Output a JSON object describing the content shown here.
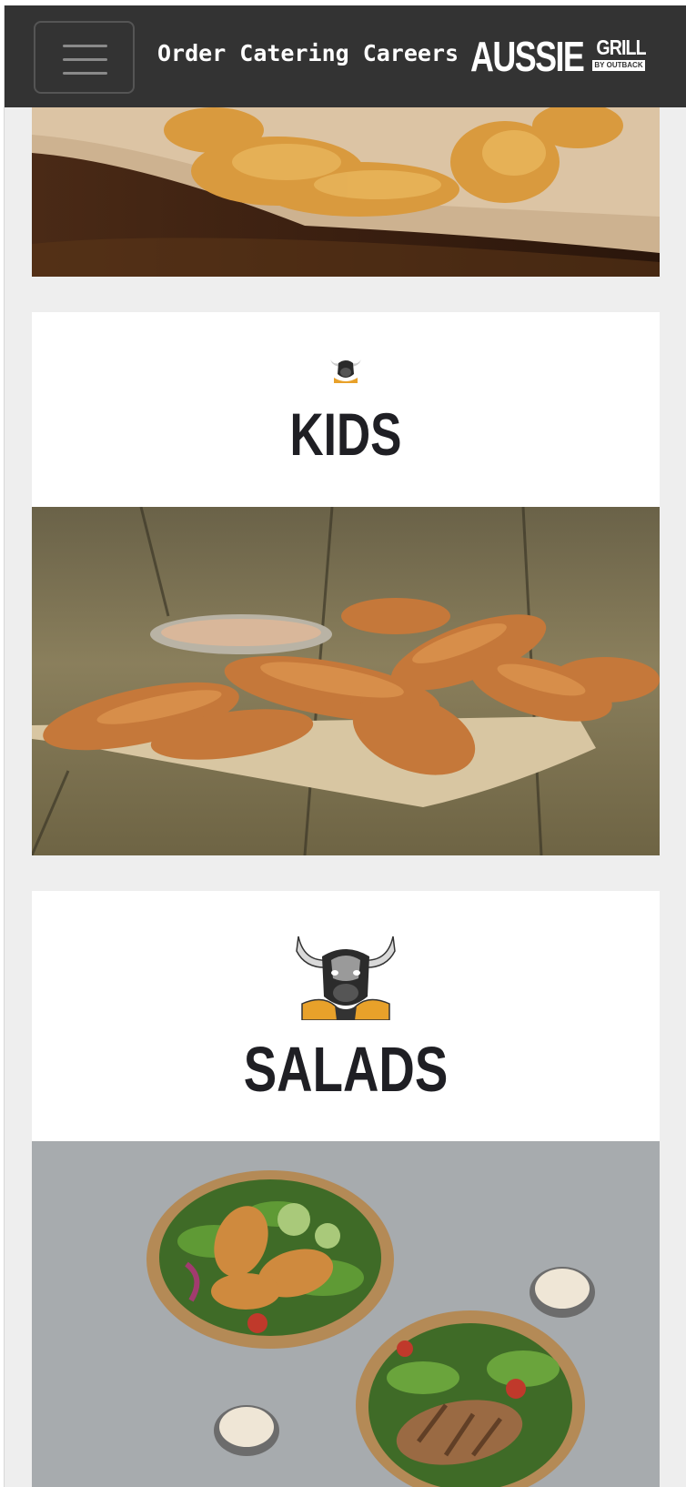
{
  "nav": {
    "menu_label": "Menu",
    "links": [
      "Order",
      "Catering",
      "Careers"
    ],
    "logo": {
      "main": "AUSSIE",
      "grill": "GRILL",
      "sub": "BY OUTBACK"
    }
  },
  "sections": [
    {
      "title": "KIDS",
      "mascot": "bull-mascot-icon",
      "image": "chicken-tenders-photo"
    },
    {
      "title": "SALADS",
      "mascot": "bull-mascot-icon",
      "image": "salad-bowls-photo"
    }
  ],
  "colors": {
    "navbar": "#333333",
    "page_bg": "#eeeeee",
    "title": "#1f1f24",
    "accent_orange": "#e8a12a"
  }
}
